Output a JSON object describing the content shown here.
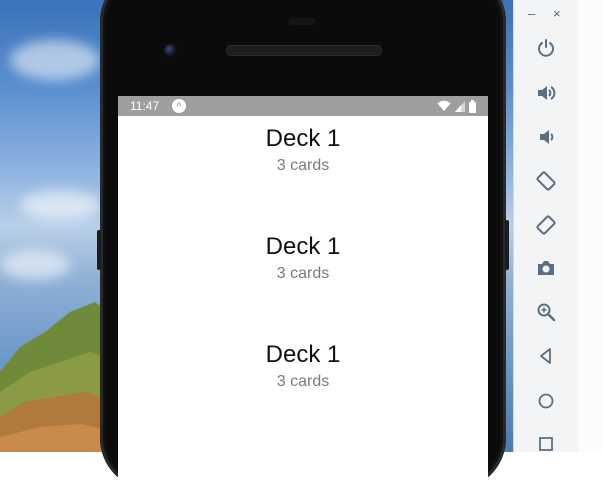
{
  "statusbar": {
    "time": "11:47",
    "expo_badge": "^"
  },
  "decks": [
    {
      "title": "Deck 1",
      "count": "3 cards"
    },
    {
      "title": "Deck 1",
      "count": "3 cards"
    },
    {
      "title": "Deck 1",
      "count": "3 cards"
    }
  ],
  "emulator": {
    "minimize_label": "–",
    "close_label": "×",
    "tools": [
      "power-icon",
      "volume-up-icon",
      "volume-down-icon",
      "rotate-left-icon",
      "rotate-right-icon",
      "camera-icon",
      "zoom-icon",
      "back-icon",
      "home-icon",
      "overview-icon"
    ]
  },
  "colors": {
    "statusbar": "#9e9e9e",
    "icon": "#5a6e84"
  }
}
